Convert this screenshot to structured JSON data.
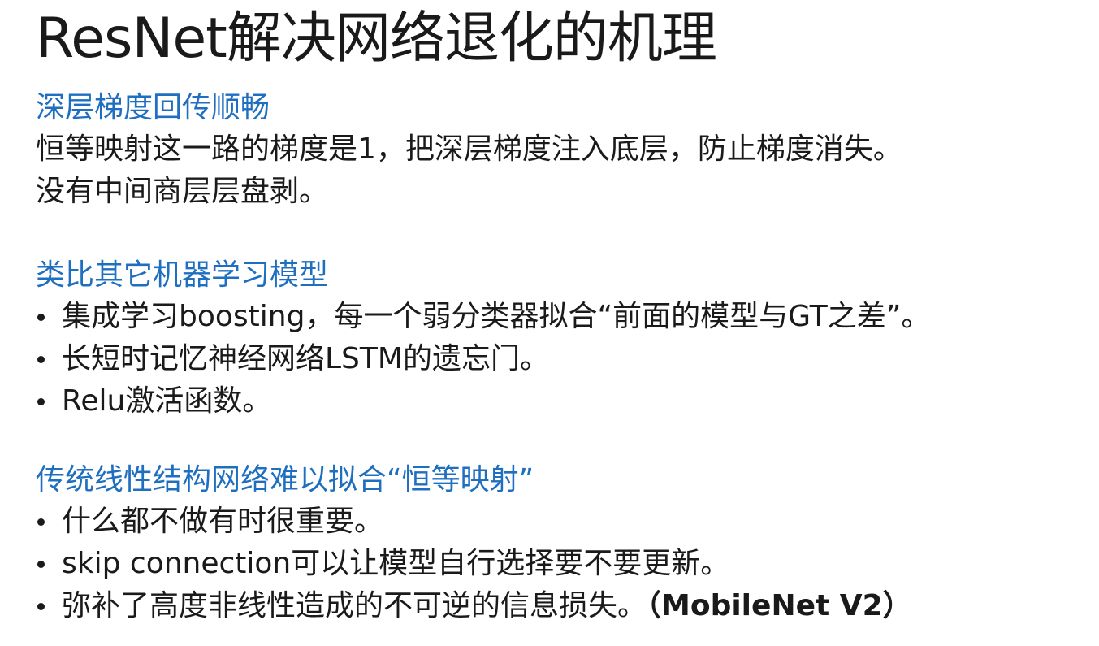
{
  "title": "ResNet解决网络退化的机理",
  "sections": [
    {
      "heading": "深层梯度回传顺畅",
      "lines": [
        "恒等映射这一路的梯度是1，把深层梯度注入底层，防止梯度消失。",
        "没有中间商层层盘剥。"
      ]
    },
    {
      "heading": "类比其它机器学习模型",
      "bullets": [
        "集成学习boosting，每一个弱分类器拟合“前面的模型与GT之差”。",
        "长短时记忆神经网络LSTM的遗忘门。",
        "Relu激活函数。"
      ]
    },
    {
      "heading": "传统线性结构网络难以拟合“恒等映射”",
      "bullets": [
        "什么都不做有时很重要。",
        "skip connection可以让模型自行选择要不要更新。",
        "弥补了高度非线性造成的不可逆的信息损失。"
      ],
      "last_bullet_suffix": "（MobileNet V2）"
    }
  ],
  "colors": {
    "heading": "#1f6fc0",
    "text": "#1a1a1a",
    "background": "#ffffff"
  }
}
